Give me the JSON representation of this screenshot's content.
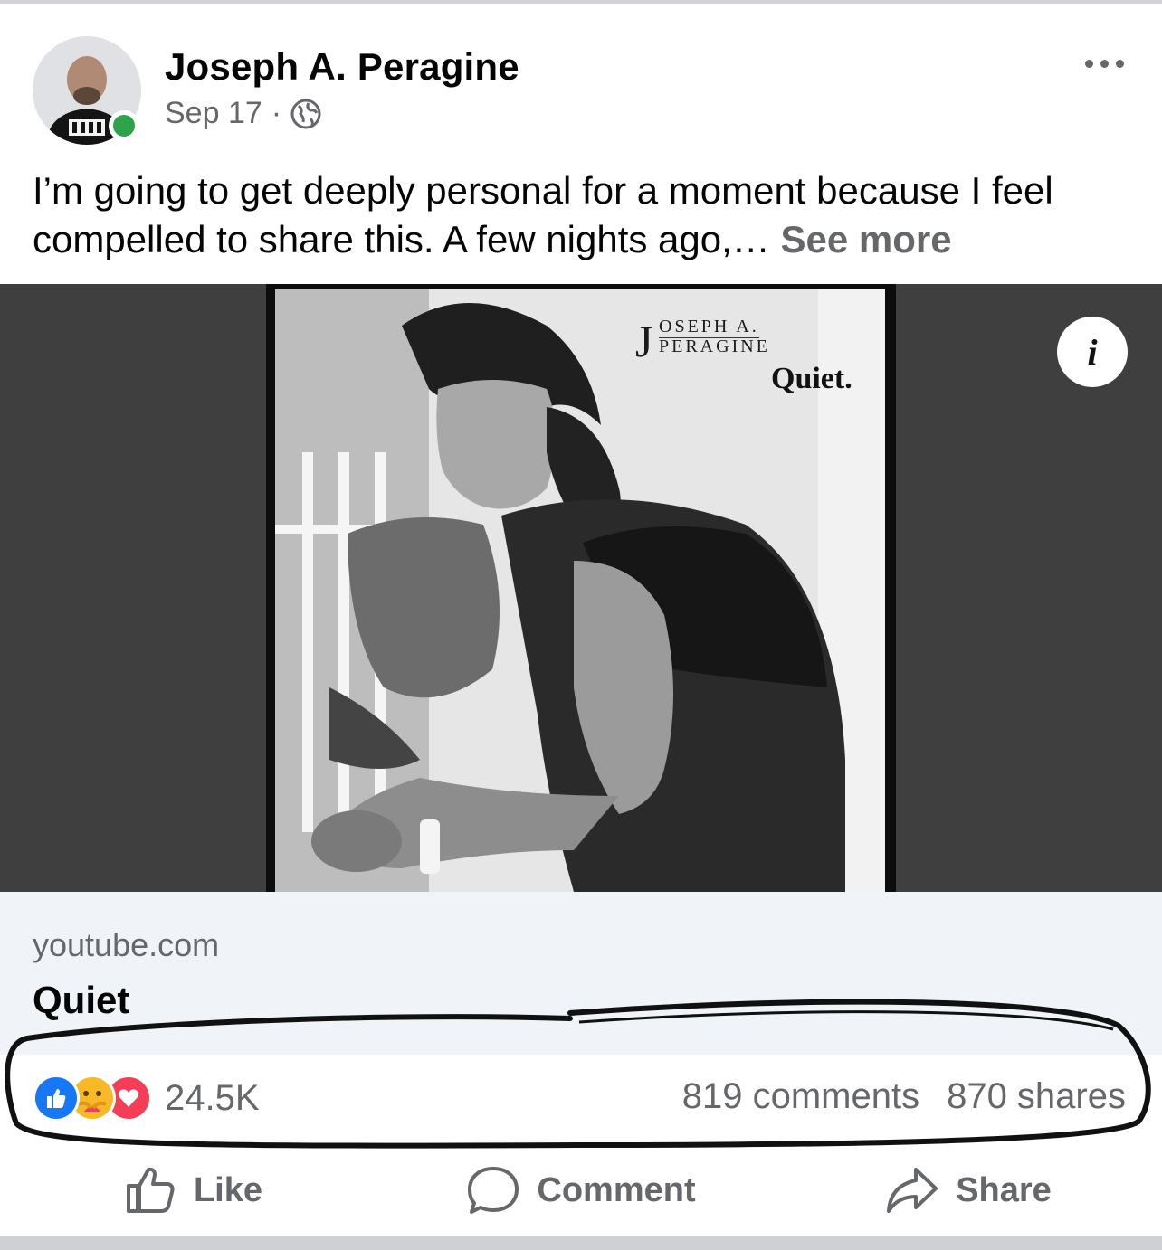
{
  "post": {
    "author": "Joseph A. Peragine",
    "date": "Sep 17",
    "separator": "·",
    "privacy_icon": "globe-icon",
    "text": "I’m going to get deeply personal for a moment because I feel compelled to share this. A few nights ago,… ",
    "see_more": "See more"
  },
  "media": {
    "brand_initial": "J",
    "brand_line1": "OSEPH   A.",
    "brand_line2": "PERAGINE",
    "poster_title": "Quiet.",
    "info_label": "i"
  },
  "link": {
    "domain": "youtube.com",
    "title": "Quiet"
  },
  "engagement": {
    "reaction_count": "24.5K",
    "comments": "819 comments",
    "shares": "870 shares",
    "reaction_icons": [
      "like-icon",
      "care-icon",
      "love-icon"
    ],
    "colors": {
      "like": "#1877f2",
      "care": "#f7b928",
      "love": "#f33e58",
      "online": "#31a24c"
    }
  },
  "actions": {
    "like": "Like",
    "comment": "Comment",
    "share": "Share"
  }
}
